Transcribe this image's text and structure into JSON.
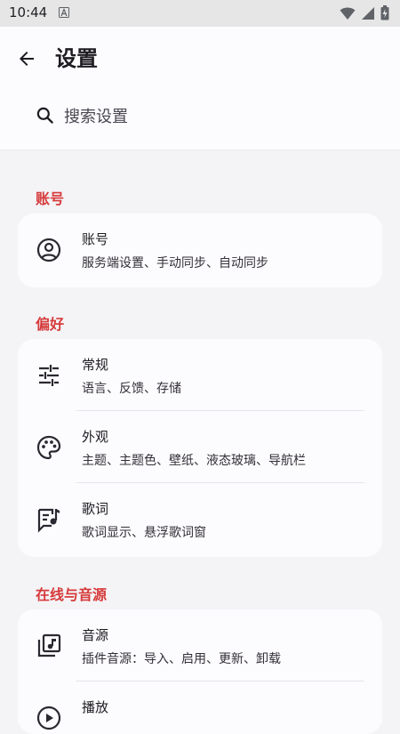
{
  "status_bar": {
    "time": "10:44"
  },
  "header": {
    "title": "设置",
    "back_icon": "arrow-back-icon"
  },
  "search": {
    "placeholder": "搜索设置",
    "icon": "search-icon"
  },
  "colors": {
    "accent": "#d63a3a",
    "background": "#f4f3f6",
    "card": "#fcfbfd"
  },
  "sections": [
    {
      "title": "账号",
      "items": [
        {
          "icon": "account-circle-icon",
          "title": "账号",
          "subtitle": "服务端设置、手动同步、自动同步"
        }
      ]
    },
    {
      "title": "偏好",
      "items": [
        {
          "icon": "sliders-icon",
          "title": "常规",
          "subtitle": "语言、反馈、存储"
        },
        {
          "icon": "palette-icon",
          "title": "外观",
          "subtitle": "主题、主题色、壁纸、液态玻璃、导航栏"
        },
        {
          "icon": "lyrics-icon",
          "title": "歌词",
          "subtitle": "歌词显示、悬浮歌词窗"
        }
      ]
    },
    {
      "title": "在线与音源",
      "items": [
        {
          "icon": "music-library-icon",
          "title": "音源",
          "subtitle": "插件音源：导入、启用、更新、卸载"
        },
        {
          "icon": "play-icon",
          "title": "播放",
          "subtitle": ""
        }
      ]
    }
  ]
}
